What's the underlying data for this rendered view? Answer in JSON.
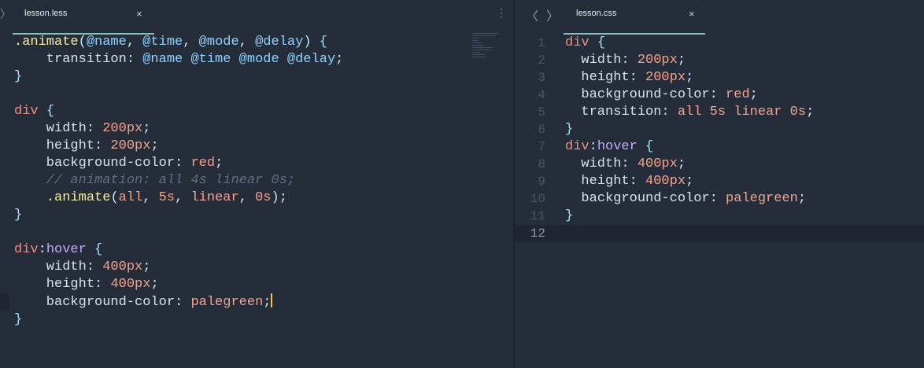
{
  "left_tab": {
    "title": "lesson.less",
    "close": "×"
  },
  "right_tab": {
    "title": "lesson.css",
    "close": "×"
  },
  "nav": {
    "left_arrow": "〈",
    "right_arrow": "〉",
    "kebab": "⋮",
    "pane_toggle": "〉"
  },
  "left_code": [
    ".animate(@name, @time, @mode, @delay) {",
    "    transition: @name @time @mode @delay;",
    "}",
    "",
    "div {",
    "    width: 200px;",
    "    height: 200px;",
    "    background-color: red;",
    "    // animation: all 4s linear 0s;",
    "    .animate(all, 5s, linear, 0s);",
    "}",
    "",
    "div:hover {",
    "    width: 400px;",
    "    height: 400px;",
    "    background-color: palegreen;",
    "}"
  ],
  "right_code": [
    "div {",
    "  width: 200px;",
    "  height: 200px;",
    "  background-color: red;",
    "  transition: all 5s linear 0s;",
    "}",
    "div:hover {",
    "  width: 400px;",
    "  height: 400px;",
    "  background-color: palegreen;",
    "}",
    ""
  ],
  "right_line_numbers": [
    "1",
    "2",
    "3",
    "4",
    "5",
    "6",
    "7",
    "8",
    "9",
    "10",
    "11",
    "12"
  ],
  "colors": {
    "background": "#262d3a",
    "selector": "#f18e82",
    "number": "#f1a38e",
    "variable": "#8fd3ff",
    "function": "#f5eda3",
    "comment": "#5f6f86",
    "pseudo": "#c7a7ff",
    "cursor": "#f7c542"
  }
}
